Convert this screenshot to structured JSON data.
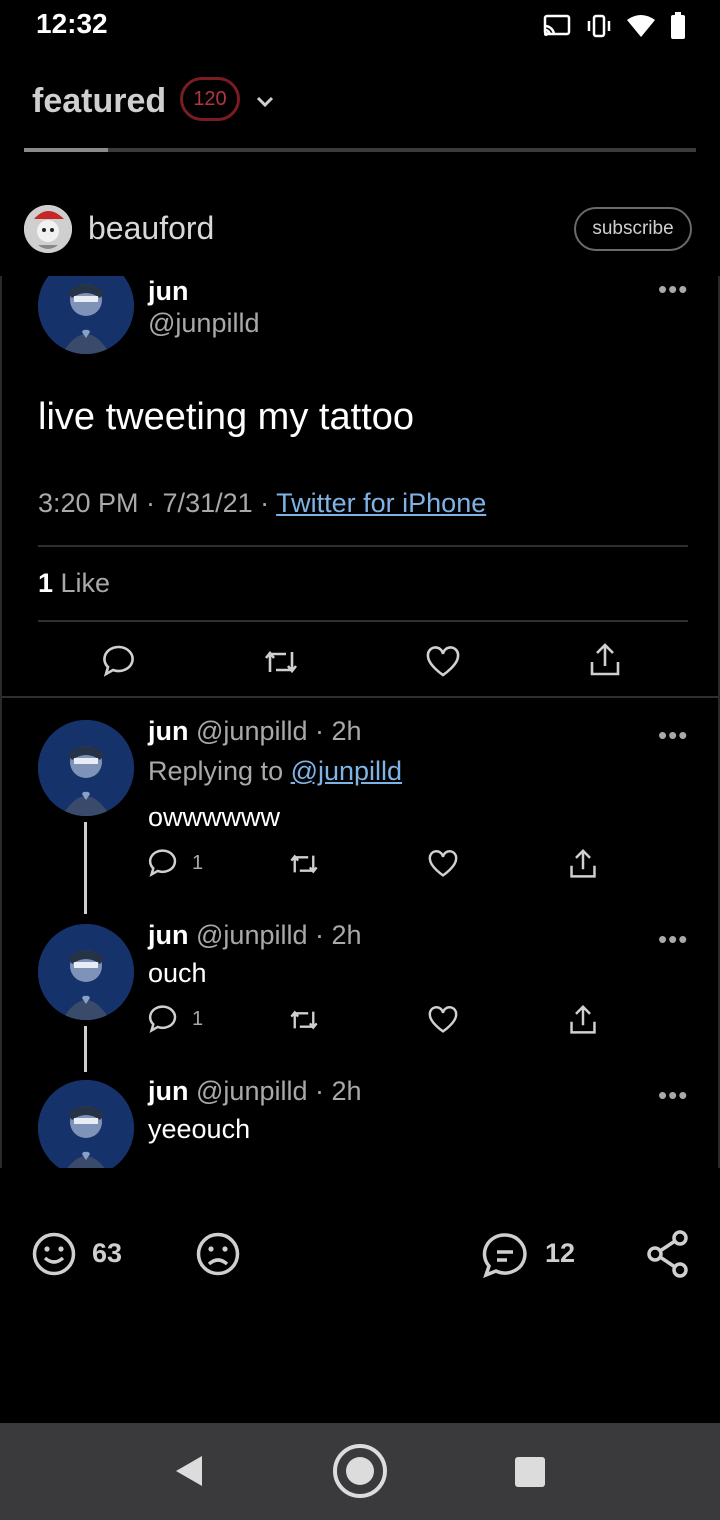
{
  "status": {
    "time": "12:32",
    "icons": [
      "cast-icon",
      "vibrate-icon",
      "wifi-icon",
      "battery-icon"
    ]
  },
  "header": {
    "title": "featured",
    "count": "120"
  },
  "post": {
    "author": "beauford",
    "subscribe_label": "subscribe"
  },
  "tweet": {
    "name": "jun",
    "handle": "@junpilld",
    "text": "live tweeting my tattoo",
    "time": "3:20 PM · 7/31/21 · ",
    "client": "Twitter for iPhone",
    "likes_count": "1",
    "likes_label": " Like",
    "more": "•••"
  },
  "replies": [
    {
      "name": "jun",
      "handle_time": "@junpilld · 2h",
      "replying_label": "Replying to ",
      "replying_to": "@junpilld",
      "text": "owwwwww",
      "reply_count": "1"
    },
    {
      "name": "jun",
      "handle_time": "@junpilld · 2h",
      "text": "ouch",
      "reply_count": "1"
    },
    {
      "name": "jun",
      "handle_time": "@junpilld · 2h",
      "text": "yeeouch"
    }
  ],
  "actions": {
    "happy_count": "63",
    "comments_count": "12"
  },
  "colors": {
    "accent_badge": "#7a1c22",
    "link": "#7fb3e6",
    "tweet_avatar_bg": "#16326a"
  }
}
